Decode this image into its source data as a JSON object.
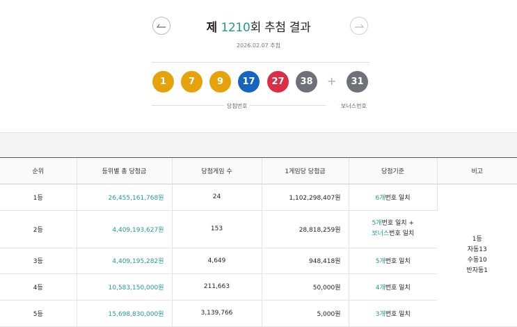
{
  "header": {
    "title_prefix": "제 ",
    "round": "1210",
    "title_suffix": "회 추첨 결과",
    "draw_date": "2026.02.07 추첨",
    "prev_icon": "arrow-left-icon",
    "next_icon": "arrow-right-icon"
  },
  "numbers": {
    "winning": [
      {
        "value": "1",
        "color": "#e5a20b"
      },
      {
        "value": "7",
        "color": "#e5a20b"
      },
      {
        "value": "9",
        "color": "#e5a20b"
      },
      {
        "value": "17",
        "color": "#1565c0"
      },
      {
        "value": "27",
        "color": "#d92f46"
      },
      {
        "value": "38",
        "color": "#6f7178"
      }
    ],
    "plus": "+",
    "bonus": {
      "value": "31",
      "color": "#6f7178"
    },
    "winning_caption": "당첨번호",
    "bonus_caption": "보너스번호"
  },
  "table": {
    "headers": [
      "순위",
      "등위별 총 당첨금",
      "당첨게임 수",
      "1게임당 당첨금",
      "당첨기준",
      "비고"
    ],
    "rows": [
      {
        "rank": "1등",
        "total": "26,455,161,768원",
        "games": "24",
        "per_game": "1,102,298,407원",
        "criteria_count": "6개",
        "criteria_text": "번호 일치",
        "criteria_extra": "",
        "criteria_extra_text": ""
      },
      {
        "rank": "2등",
        "total": "4,409,193,627원",
        "games": "153",
        "per_game": "28,818,259원",
        "criteria_count": "5개",
        "criteria_text": "번호 일치 +",
        "criteria_extra": "보너스",
        "criteria_extra_text": "번호 일치"
      },
      {
        "rank": "3등",
        "total": "4,409,195,282원",
        "games": "4,649",
        "per_game": "948,418원",
        "criteria_count": "5개",
        "criteria_text": "번호 일치",
        "criteria_extra": "",
        "criteria_extra_text": ""
      },
      {
        "rank": "4등",
        "total": "10,583,150,000원",
        "games": "211,663",
        "per_game": "50,000원",
        "criteria_count": "4개",
        "criteria_text": "번호 일치",
        "criteria_extra": "",
        "criteria_extra_text": ""
      },
      {
        "rank": "5등",
        "total": "15,698,830,000원",
        "games": "3,139,766",
        "per_game": "5,000원",
        "criteria_count": "3개",
        "criteria_text": "번호 일치",
        "criteria_extra": "",
        "criteria_extra_text": ""
      }
    ],
    "note": [
      "1등",
      "자동13",
      "수동10",
      "반자동1"
    ]
  },
  "colors": {
    "accent": "#1e9c8a"
  }
}
